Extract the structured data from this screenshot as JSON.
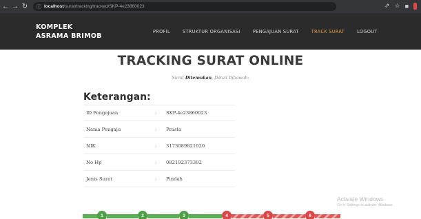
{
  "browser": {
    "back_icon": "arrow-left-icon",
    "forward_icon": "arrow-right-icon",
    "reload_icon": "reload-icon",
    "info_icon": "info-icon",
    "url_host": "localhost",
    "url_path": "/surat/tracking/tracked/SKP-4e23860023"
  },
  "site_nav": {
    "brand_line1": "KOMPLEK",
    "brand_line2": "ASRAMA BRIMOB",
    "menu": [
      {
        "label": "PROFIL",
        "active": false
      },
      {
        "label": "STRUKTUR ORGANISASI",
        "active": false
      },
      {
        "label": "PENGAJUAN SURAT",
        "active": false
      },
      {
        "label": "TRACK SURAT",
        "active": true
      },
      {
        "label": "LOGOUT",
        "active": false
      }
    ],
    "active_color": "#e3a14b"
  },
  "main": {
    "title": "TRACKING SURAT ONLINE",
    "subtitle_prefix": "Surat",
    "subtitle_bold": "Ditemukan",
    "subtitle_suffix": ", Detail Dibawah:",
    "section_title": "Keterangan:",
    "rows": [
      {
        "label": "ID Pengajuan",
        "sep": ":",
        "value": "SKP-4e23860023"
      },
      {
        "label": "Nama Pengaju",
        "sep": ":",
        "value": "Prasta"
      },
      {
        "label": "NIK",
        "sep": ":",
        "value": "3173089821020"
      },
      {
        "label": "No Hp",
        "sep": ":",
        "value": "082192373392"
      },
      {
        "label": "Jenis Surat",
        "sep": ":",
        "value": "Pindah"
      }
    ]
  },
  "tracker": {
    "steps": [
      {
        "label": "1",
        "status": "done"
      },
      {
        "label": "2",
        "status": "done"
      },
      {
        "label": "3",
        "status": "done"
      },
      {
        "label": "4",
        "status": "pending"
      },
      {
        "label": "5",
        "status": "pending"
      },
      {
        "label": "6",
        "status": "pending"
      }
    ],
    "done_color": "#5cae55",
    "pending_color": "#e35656"
  },
  "watermark": {
    "title": "Activate Windows",
    "subtitle": "Go to Settings to activate Windows."
  }
}
